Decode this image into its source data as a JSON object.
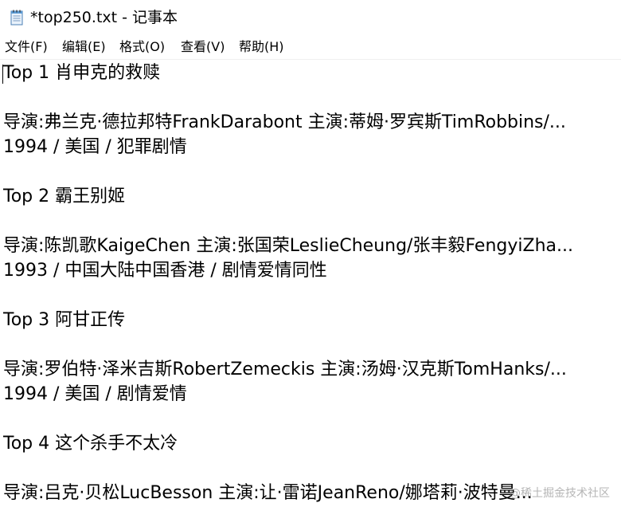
{
  "window": {
    "title": "*top250.txt - 记事本",
    "icon": "notepad-icon"
  },
  "menu": {
    "items": [
      "文件(F)",
      "编辑(E)",
      "格式(O)",
      "查看(V)",
      "帮助(H)"
    ]
  },
  "editor": {
    "lines": [
      "Top 1 肖申克的救赎",
      "导演:弗兰克·德拉邦特FrankDarabont   主演:蒂姆·罗宾斯TimRobbins/...",
      "1994 / 美国 / 犯罪剧情",
      "Top 2 霸王别姬",
      "导演:陈凯歌KaigeChen   主演:张国荣LeslieCheung/张丰毅FengyiZha...",
      "1993 / 中国大陆中国香港 / 剧情爱情同性",
      "Top 3 阿甘正传",
      "导演:罗伯特·泽米吉斯RobertZemeckis   主演:汤姆·汉克斯TomHanks/...",
      "1994 / 美国 / 剧情爱情",
      "Top 4 这个杀手不太冷",
      "导演:吕克·贝松LucBesson   主演:让·雷诺JeanReno/娜塔莉·波特曼..."
    ]
  },
  "watermark": {
    "text": "@稀土掘金技术社区"
  },
  "colors": {
    "background": "#ffffff",
    "text": "#000000"
  }
}
